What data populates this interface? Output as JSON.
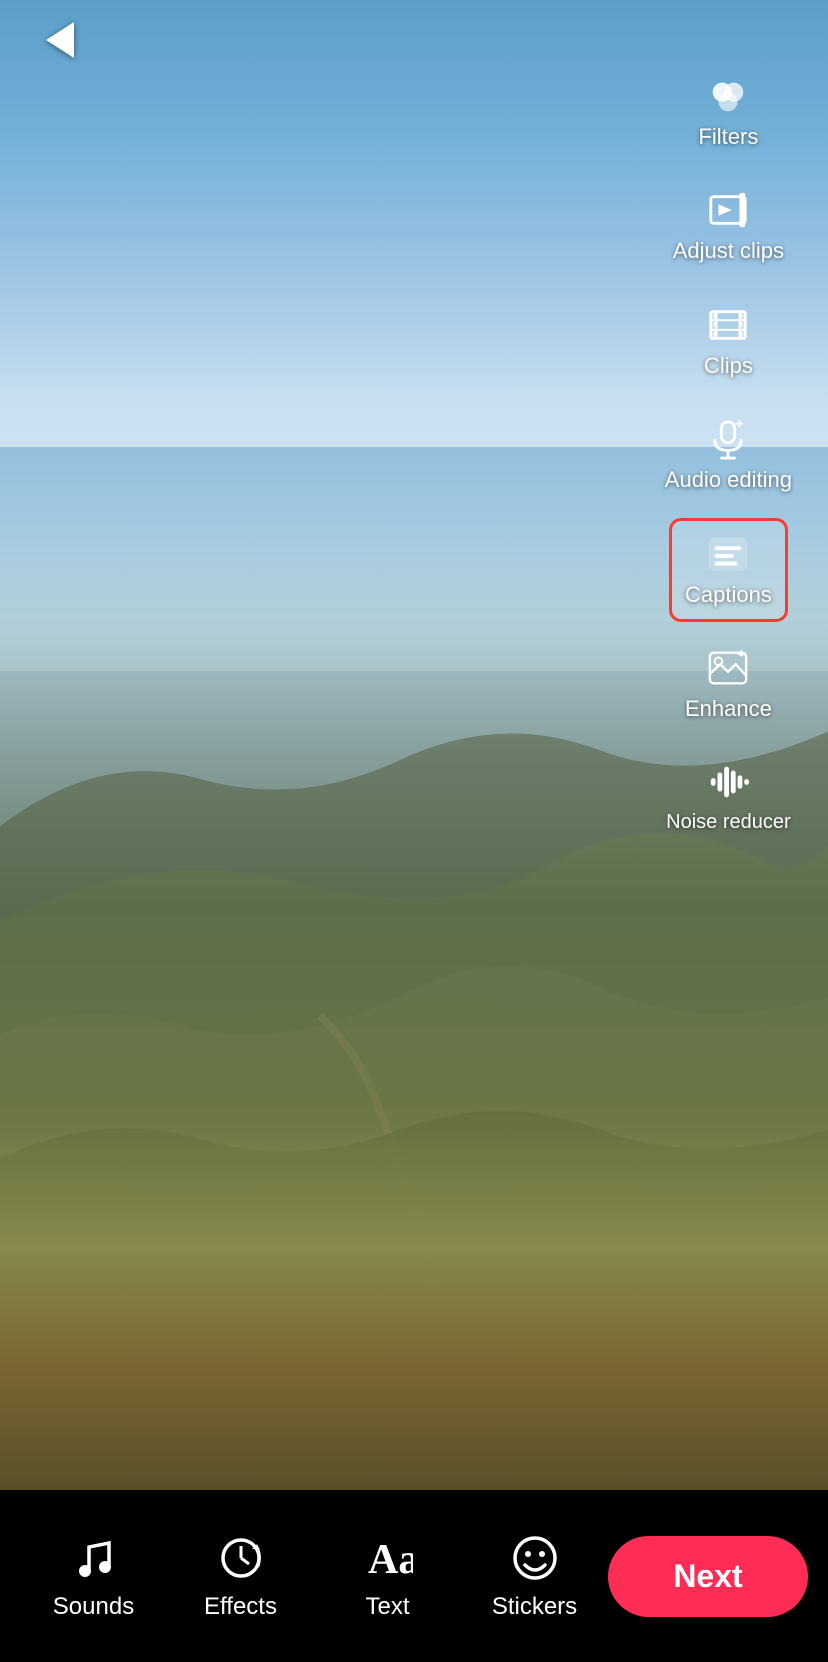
{
  "header": {
    "back_label": "back"
  },
  "sidebar": {
    "items": [
      {
        "id": "filters",
        "label": "Filters",
        "icon": "filters-icon",
        "active": false
      },
      {
        "id": "adjust-clips",
        "label": "Adjust clips",
        "icon": "adjust-clips-icon",
        "active": false
      },
      {
        "id": "clips",
        "label": "Clips",
        "icon": "clips-icon",
        "active": false
      },
      {
        "id": "audio-editing",
        "label": "Audio editing",
        "icon": "audio-editing-icon",
        "active": false
      },
      {
        "id": "captions",
        "label": "Captions",
        "icon": "captions-icon",
        "active": true
      },
      {
        "id": "enhance",
        "label": "Enhance",
        "icon": "enhance-icon",
        "active": false
      },
      {
        "id": "noise-reducer",
        "label": "Noise reducer",
        "icon": "noise-reducer-icon",
        "active": false
      }
    ]
  },
  "toolbar": {
    "items": [
      {
        "id": "sounds",
        "label": "Sounds",
        "icon": "music-note-icon"
      },
      {
        "id": "effects",
        "label": "Effects",
        "icon": "effects-icon"
      },
      {
        "id": "text",
        "label": "Text",
        "icon": "text-icon"
      },
      {
        "id": "stickers",
        "label": "Stickers",
        "icon": "stickers-icon"
      }
    ],
    "next_label": "Next"
  },
  "colors": {
    "active_border": "#ff3b30",
    "next_button_bg": "#ff2d55",
    "toolbar_bg": "#000000",
    "text_primary": "#ffffff"
  }
}
